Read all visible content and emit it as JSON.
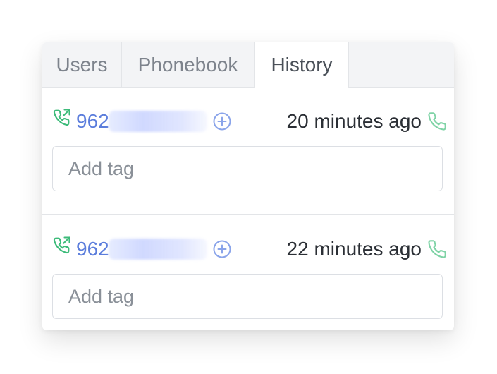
{
  "tabs": [
    {
      "label": "Users"
    },
    {
      "label": "Phonebook"
    },
    {
      "label": "History"
    }
  ],
  "active_tab": "History",
  "history": [
    {
      "number": "962",
      "time": "20 minutes ago",
      "tag_placeholder": "Add tag",
      "call_direction_icon": "outgoing-call-icon",
      "add_icon": "add-contact-icon",
      "dial_icon": "phone-icon"
    },
    {
      "number": "962",
      "time": "22 minutes ago",
      "tag_placeholder": "Add tag",
      "call_direction_icon": "outgoing-call-icon",
      "add_icon": "add-contact-icon",
      "dial_icon": "phone-icon"
    }
  ],
  "colors": {
    "number": "#5b7ddc",
    "call_icon": "#3dbb7a",
    "add_icon": "#8aa4ea",
    "active_tab_bg": "#ffffff",
    "tab_bar_bg": "#f3f4f6"
  }
}
